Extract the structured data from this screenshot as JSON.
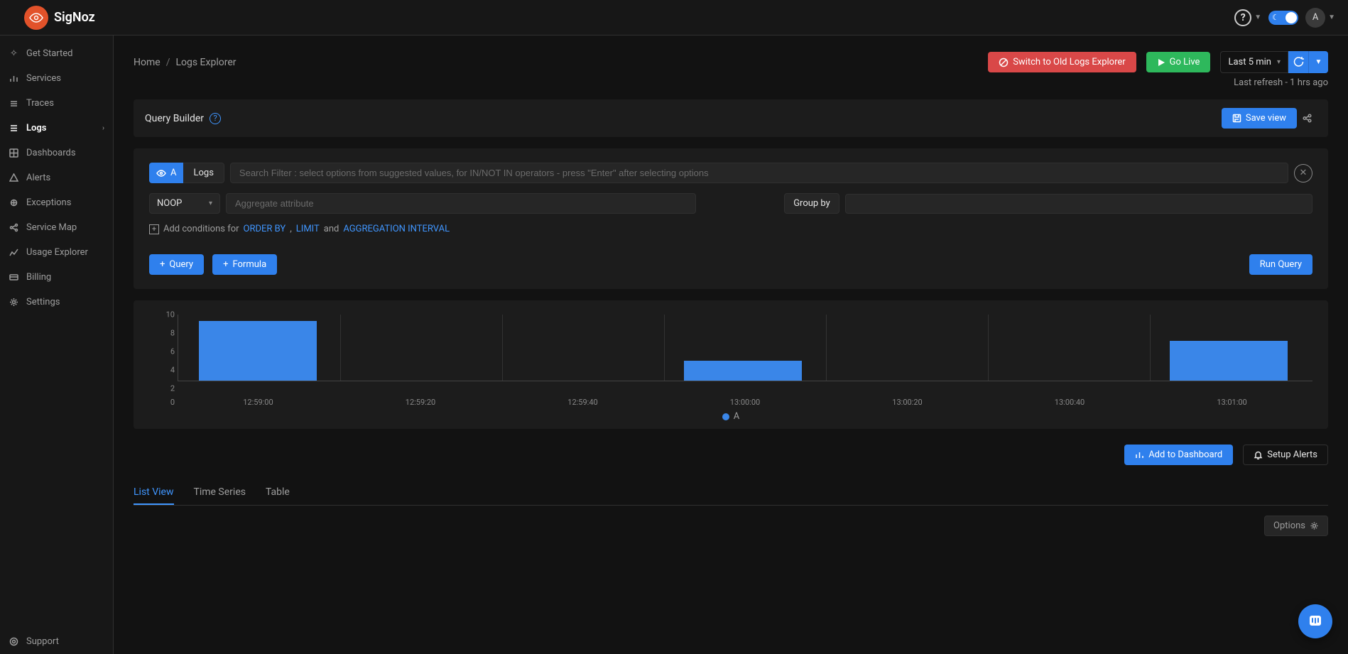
{
  "brand": "SigNoz",
  "avatar_letter": "A",
  "sidebar": {
    "items": [
      {
        "label": "Get Started",
        "icon": "rocket-icon"
      },
      {
        "label": "Services",
        "icon": "bar-chart-icon"
      },
      {
        "label": "Traces",
        "icon": "layers-icon"
      },
      {
        "label": "Logs",
        "icon": "list-icon",
        "active": true,
        "expandable": true
      },
      {
        "label": "Dashboards",
        "icon": "dashboard-icon"
      },
      {
        "label": "Alerts",
        "icon": "alert-icon"
      },
      {
        "label": "Exceptions",
        "icon": "bug-icon"
      },
      {
        "label": "Service Map",
        "icon": "share-icon"
      },
      {
        "label": "Usage Explorer",
        "icon": "line-chart-icon"
      },
      {
        "label": "Billing",
        "icon": "card-icon"
      },
      {
        "label": "Settings",
        "icon": "gear-icon"
      }
    ],
    "support_label": "Support"
  },
  "breadcrumb": {
    "home": "Home",
    "current": "Logs Explorer"
  },
  "buttons": {
    "switch_old": "Switch to Old Logs Explorer",
    "go_live": "Go Live",
    "save_view": "Save view",
    "query": "Query",
    "formula": "Formula",
    "run_query": "Run Query",
    "add_dashboard": "Add to Dashboard",
    "setup_alerts": "Setup Alerts",
    "options": "Options"
  },
  "time": {
    "range_label": "Last 5 min",
    "last_refresh": "Last refresh - 1 hrs ago"
  },
  "query_builder": {
    "title": "Query Builder",
    "query_letter": "A",
    "data_source": "Logs",
    "search_placeholder": "Search Filter : select options from suggested values, for IN/NOT IN operators - press \"Enter\" after selecting options",
    "aggregate_op": "NOOP",
    "aggregate_placeholder": "Aggregate attribute",
    "group_by_label": "Group by",
    "conditions_prefix": "Add conditions for",
    "conditions_links": {
      "order_by": "ORDER BY",
      "limit": "LIMIT",
      "agg_interval": "AGGREGATION INTERVAL"
    },
    "and_text": "and",
    "comma": ","
  },
  "tabs": [
    {
      "label": "List View",
      "active": true
    },
    {
      "label": "Time Series"
    },
    {
      "label": "Table"
    }
  ],
  "chart": {
    "legend_label": "A"
  },
  "chart_data": {
    "type": "bar",
    "title": "",
    "xlabel": "",
    "ylabel": "",
    "ylim": [
      0,
      10
    ],
    "y_ticks": [
      0,
      2,
      4,
      6,
      8,
      10
    ],
    "x_ticks": [
      "12:59:00",
      "12:59:20",
      "12:59:40",
      "13:00:00",
      "13:00:20",
      "13:00:40",
      "13:01:00"
    ],
    "series": [
      {
        "name": "A",
        "color": "#3a86e8",
        "values": [
          {
            "x": "12:59:00",
            "y": 9
          },
          {
            "x": "13:00:00",
            "y": 3
          },
          {
            "x": "13:01:00",
            "y": 6
          }
        ]
      }
    ]
  }
}
